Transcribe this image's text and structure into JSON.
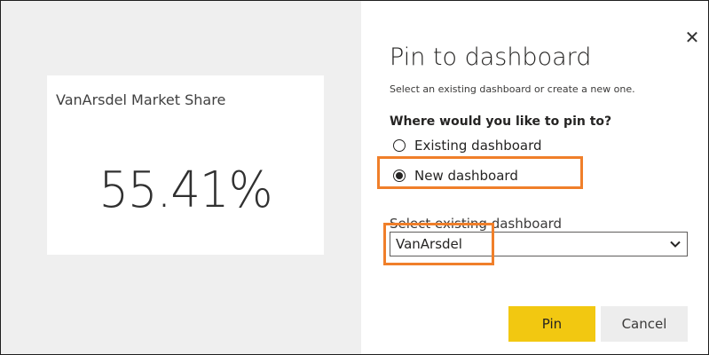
{
  "tile": {
    "title": "VanArsdel Market Share",
    "value": "55.41%"
  },
  "dialog": {
    "close_icon": "close-icon",
    "title": "Pin to dashboard",
    "subtitle": "Select an existing dashboard or create a new one.",
    "question": "Where would you like to pin to?",
    "options": [
      {
        "label": "Existing dashboard",
        "selected": false
      },
      {
        "label": "New dashboard",
        "selected": true
      }
    ],
    "select_label": "Select existing dashboard",
    "select_value": "VanArsdel",
    "select_icon": "chevron-down-icon",
    "pin_label": "Pin",
    "cancel_label": "Cancel"
  },
  "colors": {
    "pin_button": "#f2c811",
    "highlight": "#f07f2a",
    "preview_background": "#efefef"
  }
}
